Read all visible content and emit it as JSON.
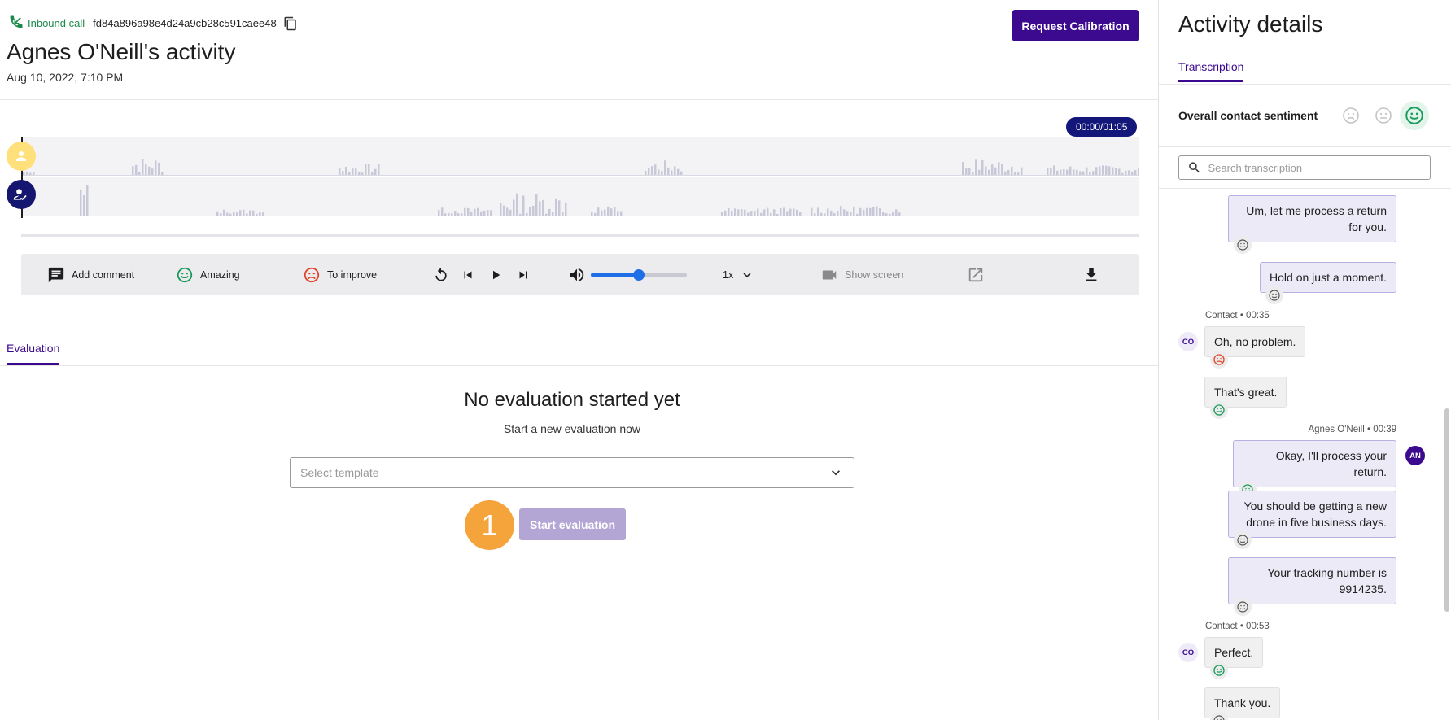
{
  "call": {
    "type_label": "Inbound call",
    "id": "fd84a896a98e4d24a9cb28c591caee48"
  },
  "header": {
    "title": "Agnes O'Neill's activity",
    "date": "Aug 10, 2022, 7:10 PM",
    "calibration_button": "Request Calibration"
  },
  "player": {
    "timer": "00:00/01:05",
    "add_comment": "Add comment",
    "amazing": "Amazing",
    "to_improve": "To improve",
    "volume_level": 0.5,
    "speed": "1x",
    "show_screen": "Show screen"
  },
  "evaluation": {
    "tab": "Evaluation",
    "empty_title": "No evaluation started yet",
    "empty_subtitle": "Start a new evaluation now",
    "select_placeholder": "Select template",
    "step_number": "1",
    "start_button": "Start evaluation"
  },
  "panel": {
    "title": "Activity details",
    "tab": "Transcription",
    "sentiment_label": "Overall contact sentiment",
    "sentiment_selected": "positive",
    "search_placeholder": "Search transcription"
  },
  "transcript": {
    "messages": [
      {
        "speaker": "agent",
        "text_lines": [
          "Um, let me process a return",
          "for you."
        ],
        "sentiment": "neutral"
      },
      {
        "speaker": "agent",
        "text_lines": [
          "Hold on just a moment."
        ],
        "sentiment": "neutral"
      },
      {
        "speaker": "contact",
        "meta": "Contact • 00:35",
        "avatar": "CO",
        "text_lines": [
          "Oh, no problem."
        ],
        "sentiment": "negative"
      },
      {
        "speaker": "contact",
        "text_lines": [
          "That's great."
        ],
        "sentiment": "positive"
      },
      {
        "speaker": "agent",
        "meta": "Agnes O'Neill • 00:39",
        "avatar": "AN",
        "text_lines": [
          "Okay, I'll process your return."
        ],
        "sentiment": "positive"
      },
      {
        "speaker": "agent",
        "text_lines": [
          "You should be getting a new",
          "drone in five business days."
        ],
        "sentiment": "neutral"
      },
      {
        "speaker": "agent",
        "text_lines": [
          "Your tracking number is",
          "9914235."
        ],
        "sentiment": "neutral"
      },
      {
        "speaker": "contact",
        "meta": "Contact • 00:53",
        "avatar": "CO",
        "text_lines": [
          "Perfect."
        ],
        "sentiment": "positive"
      },
      {
        "speaker": "contact",
        "text_lines": [
          "Thank you."
        ],
        "sentiment": "neutral"
      }
    ]
  },
  "colors": {
    "brand": "#3b0a8f",
    "positive": "#1a9a5a",
    "negative": "#e0452b",
    "contact_track": "#ffe07a",
    "agent_track": "#15166f"
  },
  "icons": {
    "call": "phone-incoming-icon",
    "copy": "copy-icon",
    "comment": "comment-icon",
    "amazing": "smile-icon",
    "improve": "frown-icon",
    "replay": "replay-icon",
    "prev": "skip-previous-icon",
    "play": "play-icon",
    "next": "skip-next-icon",
    "volume": "volume-icon",
    "speed_chevron": "chevron-down-icon",
    "screen": "video-camera-icon",
    "open": "open-external-icon",
    "download": "download-icon",
    "search": "search-icon"
  }
}
